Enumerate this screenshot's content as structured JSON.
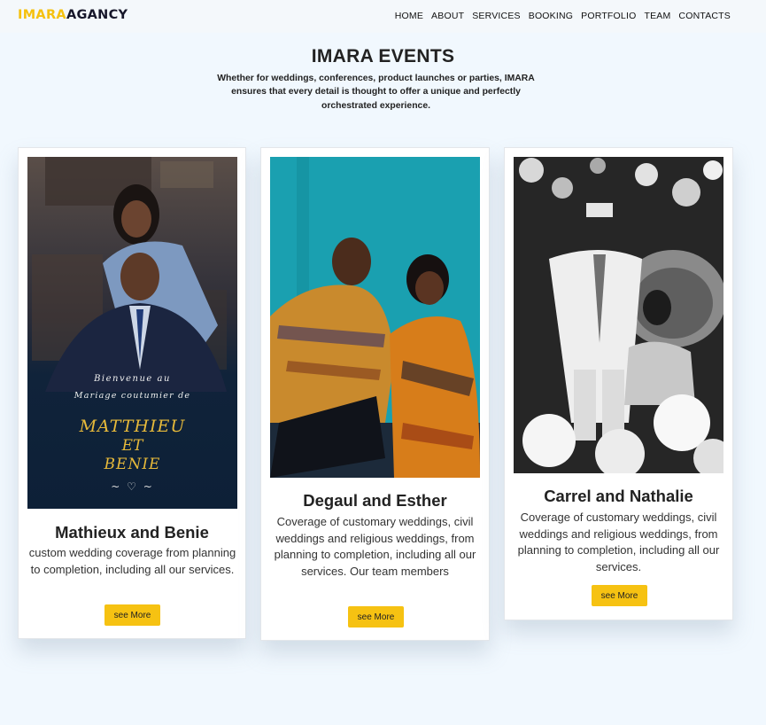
{
  "header": {
    "logo_part1": "IMARA",
    "logo_part2": "AGANCY",
    "nav": [
      "HOME",
      "ABOUT",
      "SERVICES",
      "BOOKING",
      "PORTFOLIO",
      "TEAM",
      "CONTACTS"
    ]
  },
  "hero": {
    "title": "IMARA EVENTS",
    "subtitle": "Whether for weddings, conferences, product launches or parties, IMARA ensures that every detail is thought to offer a unique and perfectly orchestrated experience."
  },
  "cards": [
    {
      "title": "Mathieux and Benie",
      "description": "custom wedding coverage from planning to completion, including all our services.",
      "button": "see More",
      "image_text": {
        "line1": "Bienvenue au",
        "line2": "Mariage coutumier de",
        "name1": "MATTHIEU",
        "name2": "ET",
        "name3": "BENIE"
      }
    },
    {
      "title": "Degaul and Esther",
      "description": "Coverage of customary weddings, civil weddings and religious weddings, from planning to completion, including all our services. Our team members",
      "button": "see More"
    },
    {
      "title": "Carrel and Nathalie",
      "description": "Coverage of customary weddings, civil weddings and religious weddings, from planning to completion, including all our services.",
      "button": "see More"
    }
  ],
  "colors": {
    "accent": "#f6c212",
    "background": "#f1f8fe"
  }
}
